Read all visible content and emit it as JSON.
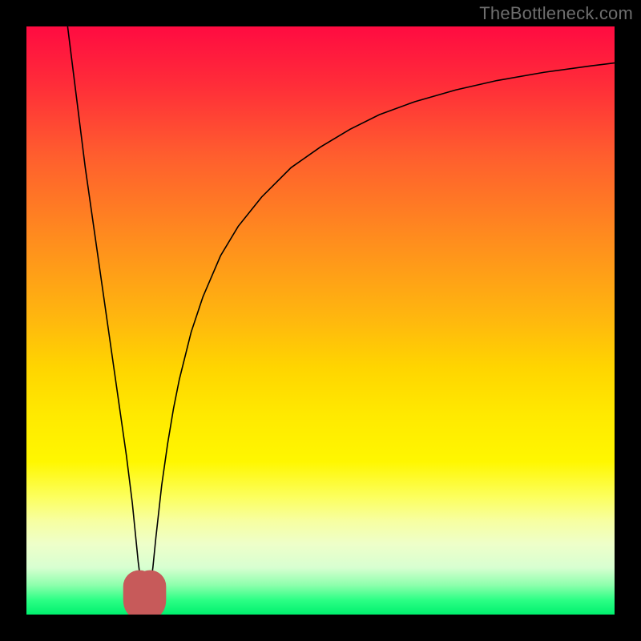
{
  "watermark": "TheBottleneck.com",
  "chart_data": {
    "type": "line",
    "title": "",
    "xlabel": "",
    "ylabel": "",
    "xlim": [
      0,
      100
    ],
    "ylim": [
      0,
      100
    ],
    "grid": false,
    "series": [
      {
        "name": "bottleneck-curve",
        "x": [
          7,
          8,
          9,
          10,
          11,
          12,
          13,
          14,
          15,
          16,
          17,
          18,
          18.5,
          19,
          19.5,
          20,
          20.5,
          21,
          21.5,
          22,
          23,
          24,
          25,
          26,
          28,
          30,
          33,
          36,
          40,
          45,
          50,
          55,
          60,
          66,
          73,
          80,
          88,
          96,
          100
        ],
        "y": [
          100,
          92,
          84,
          76,
          69,
          62,
          55,
          48,
          41,
          34,
          27,
          19,
          14,
          9,
          5,
          2.5,
          2.4,
          4,
          8,
          13,
          22,
          29,
          35,
          40,
          48,
          54,
          61,
          66,
          71,
          76,
          79.5,
          82.5,
          85,
          87.2,
          89.2,
          90.8,
          92.2,
          93.3,
          93.8
        ]
      }
    ],
    "marker": {
      "name": "optimal-region",
      "color": "#c75a5a",
      "x": [
        19.2,
        21.0
      ],
      "y_center": 2.5,
      "shape": "U"
    },
    "background_gradient": {
      "top": "#ff0b41",
      "bottom": "#00f06e",
      "meaning": "red=high bottleneck, green=low bottleneck"
    }
  }
}
